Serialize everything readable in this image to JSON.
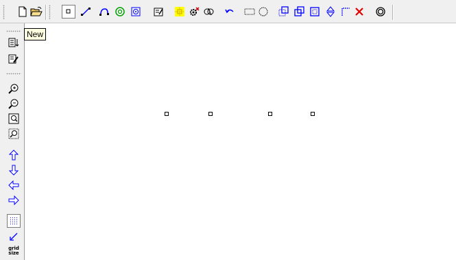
{
  "tooltip": {
    "text": "New"
  },
  "left_toolbar": {
    "grid_size_label_line1": "grid",
    "grid_size_label_line2": "size"
  },
  "icons": {
    "top": [
      "new-file-icon",
      "open-folder-icon",
      "select-rectangle-icon",
      "draw-line-icon",
      "draw-arc-icon",
      "draw-circle-node-icon",
      "component-icon",
      "properties-icon",
      "grid-select-icon",
      "settings-gear-icon",
      "route-icon",
      "undo-icon",
      "rectangle-select-icon",
      "circle-select-icon",
      "group-icon",
      "ungroup-icon",
      "frame-icon",
      "flip-vertical-icon",
      "corner-icon",
      "delete-icon",
      "ring-icon"
    ],
    "left": [
      "sort-list-icon",
      "edit-list-icon",
      "zoom-in-icon",
      "zoom-out-icon",
      "zoom-fit-icon",
      "zoom-selection-icon",
      "arrow-up-icon",
      "arrow-down-icon",
      "arrow-left-icon",
      "arrow-right-icon",
      "grid-dots-icon",
      "snap-arrow-icon",
      "grid-size-icon"
    ]
  },
  "colors": {
    "accent_blue": "#0000ff",
    "delete_red": "#e00000",
    "highlight_yellow": "#ffff00",
    "select_green": "#00a000"
  }
}
